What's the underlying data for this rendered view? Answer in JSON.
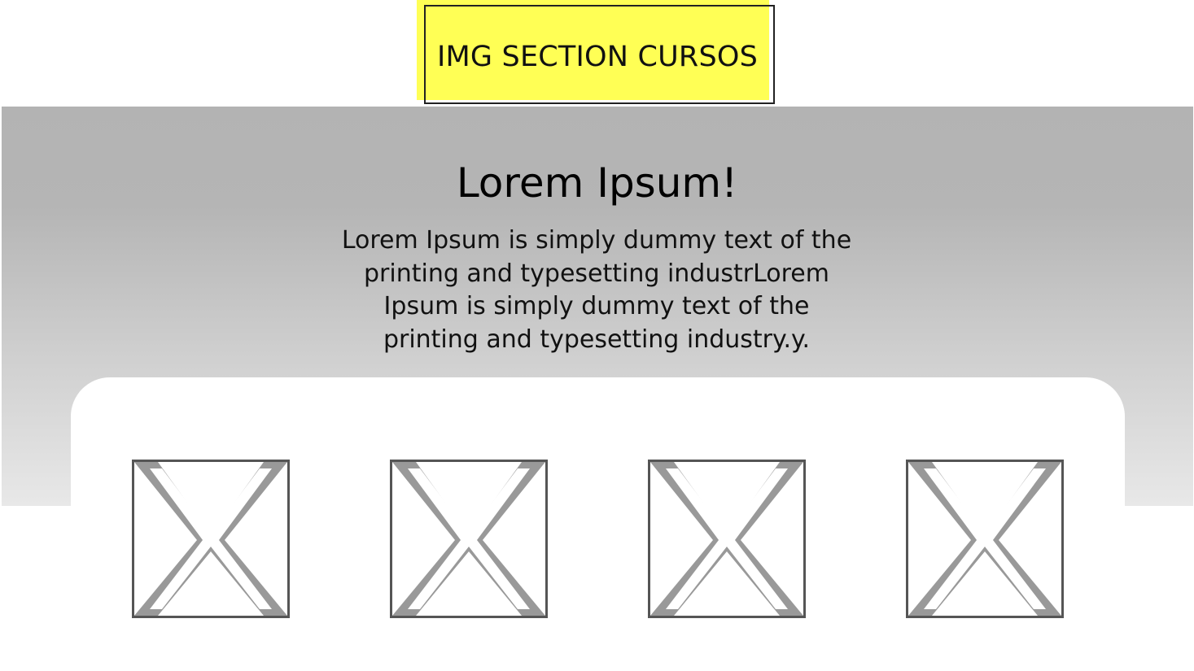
{
  "section_label": "IMG SECTION CURSOS",
  "hero": {
    "title": "Lorem Ipsum!",
    "lines": [
      "Lorem Ipsum is simply dummy text of the",
      "printing and typesetting industrLorem",
      "Ipsum is simply dummy text of the",
      "printing and typesetting industry.y."
    ]
  },
  "images": [
    {
      "icon": "image-placeholder-icon"
    },
    {
      "icon": "image-placeholder-icon"
    },
    {
      "icon": "image-placeholder-icon"
    },
    {
      "icon": "image-placeholder-icon"
    }
  ],
  "colors": {
    "label_highlight": "#ffff55",
    "band_top": "#b3b3b3",
    "band_bottom": "#e8e8e8",
    "placeholder_stroke": "#999999",
    "placeholder_border": "#555555"
  }
}
